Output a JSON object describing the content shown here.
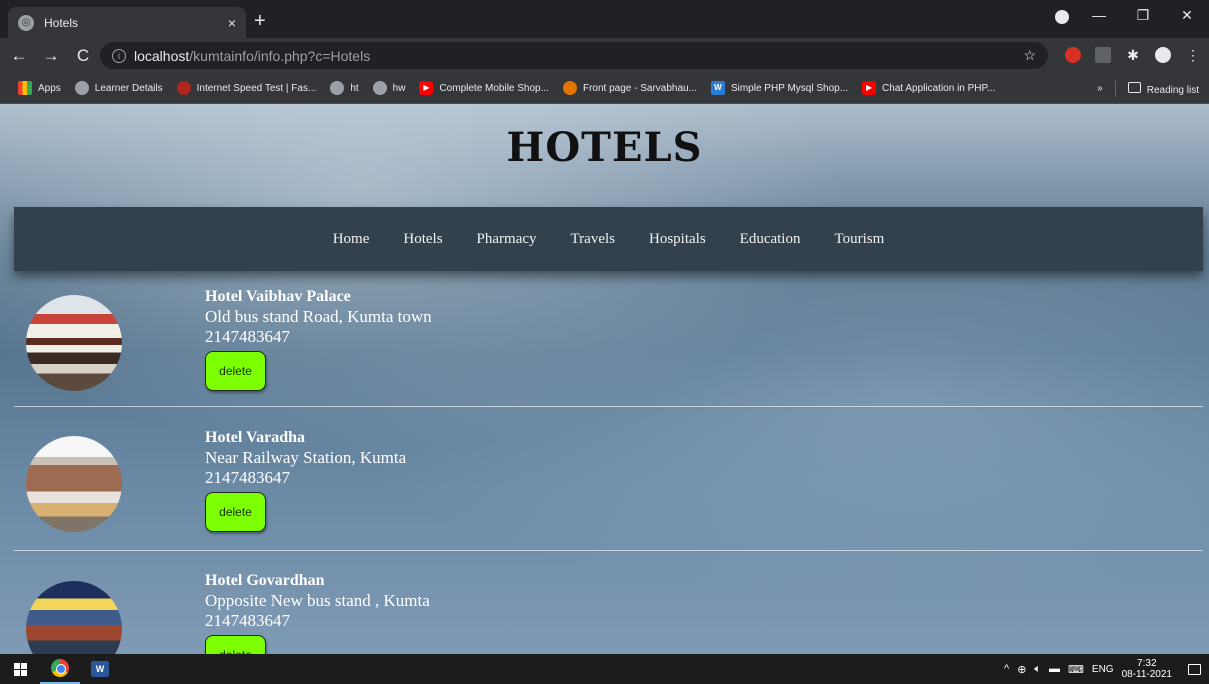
{
  "browser": {
    "tab_title": "Hotels",
    "tab_close": "×",
    "new_tab": "+",
    "url_host": "localhost",
    "url_path": "/kumtainfo/info.php?c=Hotels",
    "info_icon": "i",
    "back": "←",
    "forward": "→",
    "reload": "C",
    "star": "☆",
    "window_minimize": "—",
    "window_restore": "❐",
    "window_close": "✕",
    "bookmarks": [
      {
        "label": "Apps",
        "icon": "apps-grid-icon"
      },
      {
        "label": "Learner Details",
        "icon": "globe-icon"
      },
      {
        "label": "Internet Speed Test | Fas...",
        "icon": "speedometer-icon"
      },
      {
        "label": "ht",
        "icon": "globe-icon"
      },
      {
        "label": "hw",
        "icon": "globe-icon"
      },
      {
        "label": "Complete Mobile Shop...",
        "icon": "youtube-icon"
      },
      {
        "label": "Front page - Sarvabhau...",
        "icon": "target-icon"
      },
      {
        "label": "Simple PHP Mysql Shop...",
        "icon": "w-icon"
      },
      {
        "label": "Chat Application in PHP...",
        "icon": "youtube-icon"
      }
    ],
    "more_bookmarks": "»",
    "reading_list": "Reading list"
  },
  "page": {
    "title": "HOTELS",
    "nav": [
      "Home",
      "Hotels",
      "Pharmacy",
      "Travels",
      "Hospitals",
      "Education",
      "Tourism"
    ],
    "hotels": [
      {
        "name": "Hotel Vaibhav Palace",
        "address": "Old bus stand Road, Kumta town",
        "phone": "2147483647",
        "button": "delete"
      },
      {
        "name": "Hotel Varadha",
        "address": "Near Railway Station, Kumta",
        "phone": "2147483647",
        "button": "delete"
      },
      {
        "name": "Hotel Govardhan",
        "address": "Opposite New bus stand , Kumta",
        "phone": "2147483647",
        "button": "delete"
      }
    ]
  },
  "taskbar": {
    "word_label": "W",
    "tray_chevron": "^",
    "language": "ENG",
    "time": "7:32",
    "date": "08-11-2021"
  },
  "colors": {
    "navbar": "#33404d",
    "delete_button": "#7cff00"
  }
}
